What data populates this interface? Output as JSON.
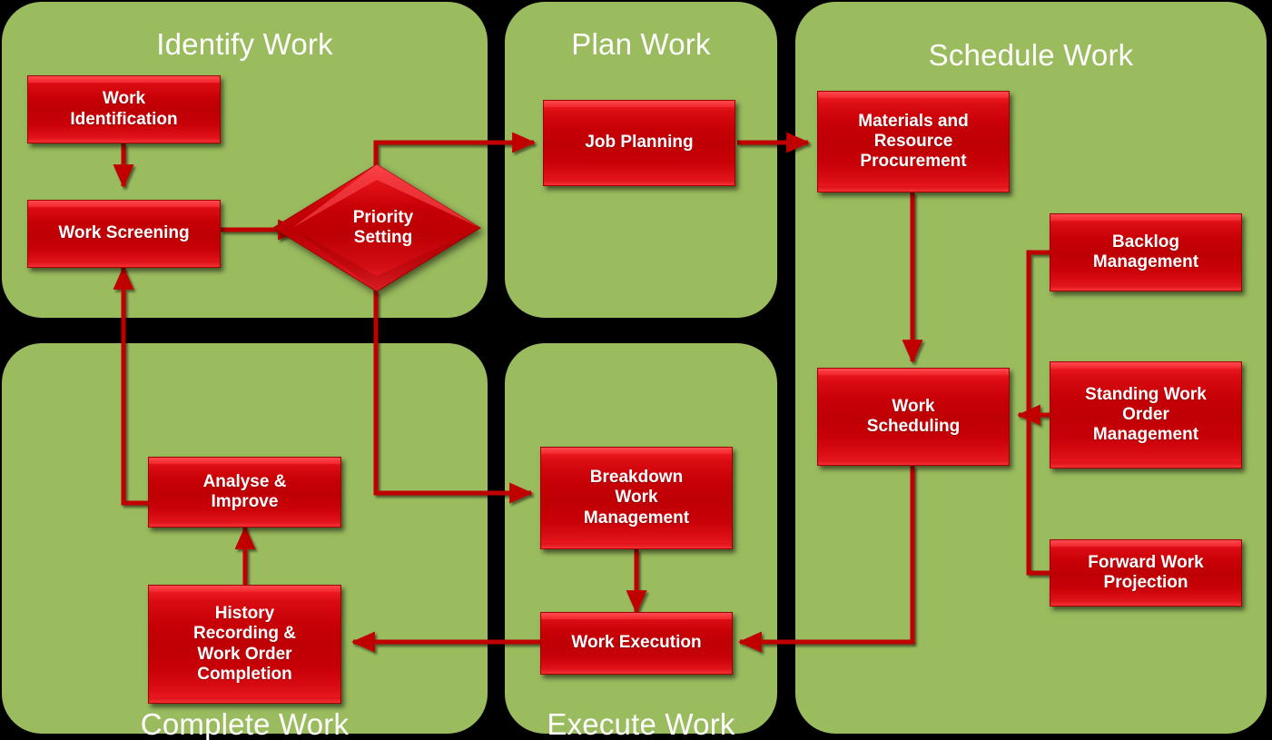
{
  "diagram": {
    "title_color": "#FFFFFF",
    "panel_color": "#9ABB5E",
    "node_color": "#C80008",
    "connector_color": "#C00000",
    "background_color": "#000000"
  },
  "panels": [
    {
      "id": "identify",
      "title": "Identify Work"
    },
    {
      "id": "plan",
      "title": "Plan Work"
    },
    {
      "id": "schedule",
      "title": "Schedule Work"
    },
    {
      "id": "complete",
      "title": "Complete Work"
    },
    {
      "id": "execute",
      "title": "Execute Work"
    }
  ],
  "nodes": {
    "work_identification": "Work\nIdentification",
    "work_screening": "Work Screening",
    "priority_setting": "Priority\nSetting",
    "job_planning": "Job Planning",
    "materials_resource_procurement": "Materials and\nResource\nProcurement",
    "backlog_management": "Backlog\nManagement",
    "standing_work_order_management": "Standing Work\nOrder\nManagement",
    "forward_work_projection": "Forward Work\nProjection",
    "work_scheduling": "Work\nScheduling",
    "breakdown_work_management": "Breakdown\nWork\nManagement",
    "work_execution": "Work Execution",
    "analyse_improve": "Analyse &\nImprove",
    "history_recording": "History\nRecording &\nWork Order\nCompletion"
  },
  "flows": [
    {
      "from": "work_identification",
      "to": "work_screening"
    },
    {
      "from": "work_screening",
      "to": "priority_setting"
    },
    {
      "from": "priority_setting",
      "to": "job_planning"
    },
    {
      "from": "priority_setting",
      "to": "breakdown_work_management"
    },
    {
      "from": "job_planning",
      "to": "materials_resource_procurement"
    },
    {
      "from": "materials_resource_procurement",
      "to": "work_scheduling"
    },
    {
      "from": "backlog_management",
      "to": "work_scheduling"
    },
    {
      "from": "standing_work_order_management",
      "to": "work_scheduling"
    },
    {
      "from": "forward_work_projection",
      "to": "work_scheduling"
    },
    {
      "from": "work_scheduling",
      "to": "work_execution"
    },
    {
      "from": "breakdown_work_management",
      "to": "work_execution"
    },
    {
      "from": "work_execution",
      "to": "history_recording"
    },
    {
      "from": "history_recording",
      "to": "analyse_improve"
    },
    {
      "from": "analyse_improve",
      "to": "work_screening"
    }
  ]
}
